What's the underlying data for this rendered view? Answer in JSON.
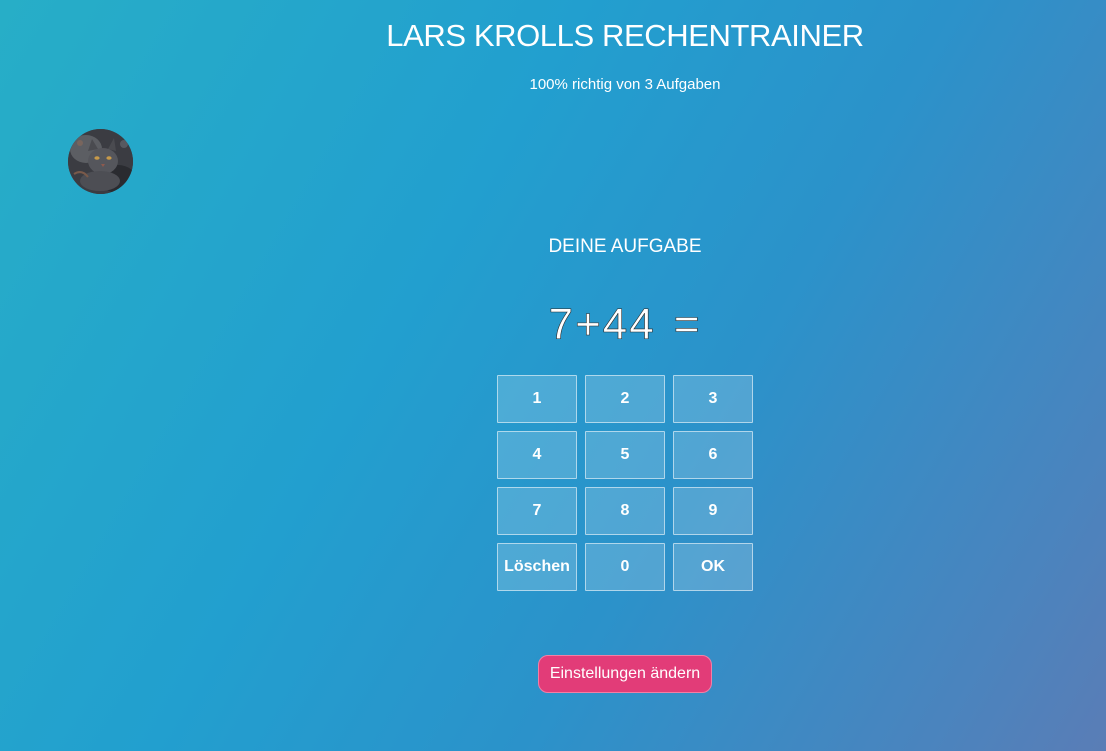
{
  "header": {
    "title": "LARS KROLLS RECHENTRAINER",
    "stats": "100% richtig von 3 Aufgaben"
  },
  "avatar": {
    "icon": "cat-photo-avatar"
  },
  "task": {
    "heading": "DEINE AUFGABE",
    "expression": "7+44",
    "equals": "="
  },
  "keypad": {
    "keys": [
      "1",
      "2",
      "3",
      "4",
      "5",
      "6",
      "7",
      "8",
      "9",
      "Löschen",
      "0",
      "OK"
    ]
  },
  "settings": {
    "label": "Einstellungen ändern"
  },
  "colors": {
    "background_start": "#27aec7",
    "background_end": "#5a7db6",
    "accent_button": "#e23c78",
    "text": "#ffffff"
  }
}
